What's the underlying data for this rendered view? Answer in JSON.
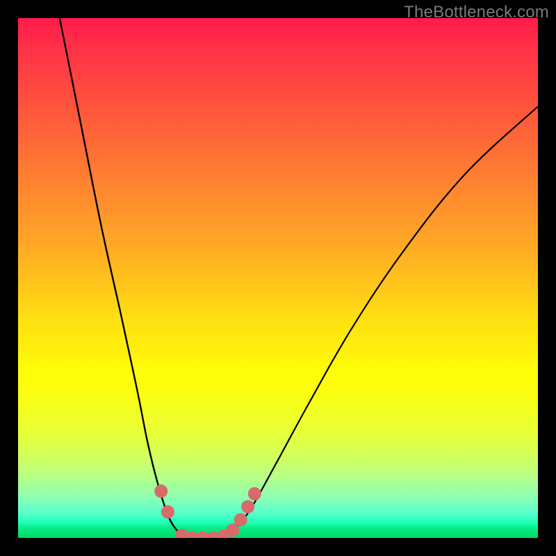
{
  "watermark": {
    "text": "TheBottleneck.com"
  },
  "colors": {
    "frame_border": "#000000",
    "curve_stroke": "#000000",
    "marker_fill": "#d86a6a",
    "marker_stroke": "#c95a5a",
    "gradient_top": "#ff1b4a",
    "gradient_bottom": "#02d864"
  },
  "chart_data": {
    "type": "line",
    "title": "",
    "xlabel": "",
    "ylabel": "",
    "xlim": [
      0,
      100
    ],
    "ylim": [
      0,
      100
    ],
    "grid": false,
    "legend": false,
    "series": [
      {
        "name": "left-branch",
        "description": "Steep descending curve from top-left into valley",
        "points": [
          {
            "x": 8,
            "y": 100
          },
          {
            "x": 12,
            "y": 80
          },
          {
            "x": 16,
            "y": 60
          },
          {
            "x": 20,
            "y": 42
          },
          {
            "x": 23,
            "y": 28
          },
          {
            "x": 25,
            "y": 18
          },
          {
            "x": 27,
            "y": 10
          },
          {
            "x": 29,
            "y": 4
          },
          {
            "x": 31,
            "y": 1
          },
          {
            "x": 33,
            "y": 0
          }
        ]
      },
      {
        "name": "valley-floor",
        "description": "Flat minimum region",
        "points": [
          {
            "x": 33,
            "y": 0
          },
          {
            "x": 40,
            "y": 0
          }
        ]
      },
      {
        "name": "right-branch",
        "description": "Ascending curve from valley toward upper-right",
        "points": [
          {
            "x": 40,
            "y": 0
          },
          {
            "x": 42,
            "y": 2
          },
          {
            "x": 45,
            "y": 6
          },
          {
            "x": 50,
            "y": 15
          },
          {
            "x": 56,
            "y": 26
          },
          {
            "x": 64,
            "y": 40
          },
          {
            "x": 74,
            "y": 55
          },
          {
            "x": 86,
            "y": 70
          },
          {
            "x": 100,
            "y": 83
          }
        ]
      }
    ],
    "markers": {
      "name": "highlight-dots",
      "color": "#d86a6a",
      "points": [
        {
          "x": 27.5,
          "y": 9
        },
        {
          "x": 28.8,
          "y": 5
        },
        {
          "x": 31.5,
          "y": 0.5
        },
        {
          "x": 33.5,
          "y": 0
        },
        {
          "x": 35.5,
          "y": 0
        },
        {
          "x": 37.5,
          "y": 0
        },
        {
          "x": 39.5,
          "y": 0.3
        },
        {
          "x": 41.3,
          "y": 1.5
        },
        {
          "x": 42.8,
          "y": 3.5
        },
        {
          "x": 44.2,
          "y": 6
        },
        {
          "x": 45.5,
          "y": 8.5
        }
      ]
    },
    "background": {
      "type": "vertical-gradient",
      "description": "Heat gradient mapped to y-axis: red (high/bad) at top through orange/yellow to green (low/good) at bottom",
      "stops": [
        {
          "pos": 0.0,
          "color": "#ff1b4a"
        },
        {
          "pos": 0.5,
          "color": "#ffd814"
        },
        {
          "pos": 0.7,
          "color": "#fcff10"
        },
        {
          "pos": 0.9,
          "color": "#a0ff90"
        },
        {
          "pos": 1.0,
          "color": "#02d864"
        }
      ]
    }
  }
}
